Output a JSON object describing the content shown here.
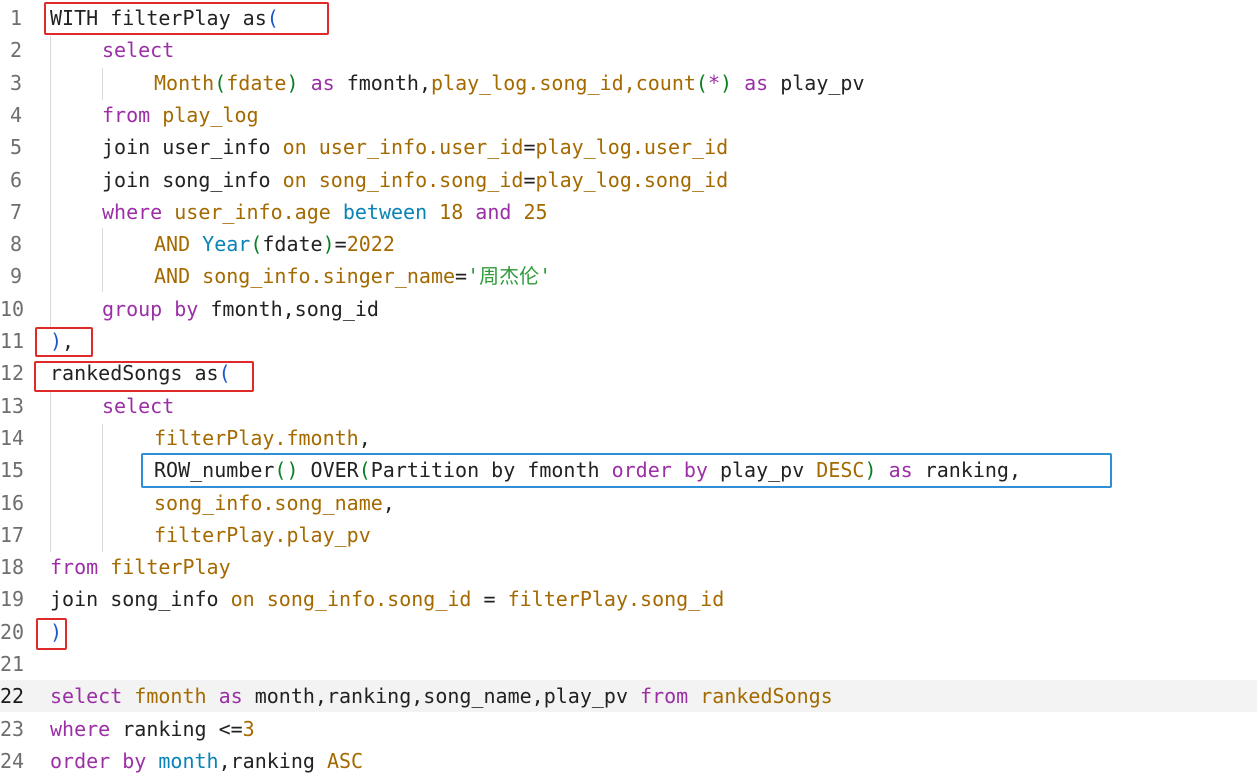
{
  "colors": {
    "default": "#222222",
    "keyword": "#9b2fa6",
    "variable": "#a46a00",
    "function": "#0a84b7",
    "number": "#0a7f24",
    "string": "#2f9b3a",
    "bracket": "#1a58c8",
    "annotation_red": "#e02a2a",
    "annotation_blue": "#2e8fd6"
  },
  "editor": {
    "current_line": 22,
    "lines": [
      {
        "num": "1",
        "indent": 0,
        "tokens": [
          {
            "t": "WITH filterPlay as",
            "c": "default"
          },
          {
            "t": "(",
            "c": "bracket"
          }
        ]
      },
      {
        "num": "2",
        "indent": 1,
        "tokens": [
          {
            "t": "select",
            "c": "keyword"
          }
        ]
      },
      {
        "num": "3",
        "indent": 2,
        "tokens": [
          {
            "t": "Month",
            "c": "variable"
          },
          {
            "t": "(",
            "c": "number"
          },
          {
            "t": "fdate",
            "c": "variable"
          },
          {
            "t": ")",
            "c": "number"
          },
          {
            "t": " as ",
            "c": "keyword"
          },
          {
            "t": "fmonth,",
            "c": "default"
          },
          {
            "t": "play_log.song_id,count",
            "c": "variable"
          },
          {
            "t": "(",
            "c": "number"
          },
          {
            "t": "*",
            "c": "keyword"
          },
          {
            "t": ")",
            "c": "number"
          },
          {
            "t": " as ",
            "c": "keyword"
          },
          {
            "t": "play_pv",
            "c": "default"
          }
        ]
      },
      {
        "num": "4",
        "indent": 1,
        "tokens": [
          {
            "t": "from ",
            "c": "keyword"
          },
          {
            "t": "play_log",
            "c": "variable"
          }
        ]
      },
      {
        "num": "5",
        "indent": 1,
        "tokens": [
          {
            "t": "join user_info ",
            "c": "default"
          },
          {
            "t": "on ",
            "c": "variable"
          },
          {
            "t": "user_info.user_id",
            "c": "variable"
          },
          {
            "t": "=",
            "c": "default"
          },
          {
            "t": "play_log.user_id",
            "c": "variable"
          }
        ]
      },
      {
        "num": "6",
        "indent": 1,
        "tokens": [
          {
            "t": "join song_info ",
            "c": "default"
          },
          {
            "t": "on ",
            "c": "variable"
          },
          {
            "t": "song_info.song_id",
            "c": "variable"
          },
          {
            "t": "=",
            "c": "default"
          },
          {
            "t": "play_log.song_id",
            "c": "variable"
          }
        ]
      },
      {
        "num": "7",
        "indent": 1,
        "tokens": [
          {
            "t": "where ",
            "c": "keyword"
          },
          {
            "t": "user_info.age ",
            "c": "variable"
          },
          {
            "t": "between ",
            "c": "function"
          },
          {
            "t": "18 ",
            "c": "variable"
          },
          {
            "t": "and ",
            "c": "keyword"
          },
          {
            "t": "25",
            "c": "variable"
          }
        ]
      },
      {
        "num": "8",
        "indent": 2,
        "tokens": [
          {
            "t": "AND ",
            "c": "variable"
          },
          {
            "t": "Year",
            "c": "function"
          },
          {
            "t": "(",
            "c": "number"
          },
          {
            "t": "fdate",
            "c": "default"
          },
          {
            "t": ")",
            "c": "number"
          },
          {
            "t": "=",
            "c": "default"
          },
          {
            "t": "2022",
            "c": "variable"
          }
        ]
      },
      {
        "num": "9",
        "indent": 2,
        "tokens": [
          {
            "t": "AND ",
            "c": "variable"
          },
          {
            "t": "song_info.singer_name",
            "c": "variable"
          },
          {
            "t": "=",
            "c": "default"
          },
          {
            "t": "'周杰伦'",
            "c": "string"
          }
        ]
      },
      {
        "num": "10",
        "indent": 1,
        "tokens": [
          {
            "t": "group by ",
            "c": "keyword"
          },
          {
            "t": "fmonth,song_id",
            "c": "default"
          }
        ]
      },
      {
        "num": "11",
        "indent": 0,
        "tokens": [
          {
            "t": ")",
            "c": "bracket"
          },
          {
            "t": ",",
            "c": "default"
          }
        ]
      },
      {
        "num": "12",
        "indent": 0,
        "tokens": [
          {
            "t": "rankedSongs as",
            "c": "default"
          },
          {
            "t": "(",
            "c": "bracket"
          }
        ]
      },
      {
        "num": "13",
        "indent": 1,
        "tokens": [
          {
            "t": "select",
            "c": "keyword"
          }
        ]
      },
      {
        "num": "14",
        "indent": 2,
        "tokens": [
          {
            "t": "filterPlay.fmonth",
            "c": "variable"
          },
          {
            "t": ",",
            "c": "default"
          }
        ]
      },
      {
        "num": "15",
        "indent": 2,
        "tokens": [
          {
            "t": "ROW_number",
            "c": "default"
          },
          {
            "t": "() ",
            "c": "number"
          },
          {
            "t": "OVER",
            "c": "default"
          },
          {
            "t": "(",
            "c": "number"
          },
          {
            "t": "Partition by fmonth ",
            "c": "default"
          },
          {
            "t": "order by ",
            "c": "keyword"
          },
          {
            "t": "play_pv ",
            "c": "default"
          },
          {
            "t": "DESC",
            "c": "variable"
          },
          {
            "t": ") ",
            "c": "number"
          },
          {
            "t": "as ",
            "c": "keyword"
          },
          {
            "t": "ranking,",
            "c": "default"
          }
        ]
      },
      {
        "num": "16",
        "indent": 2,
        "tokens": [
          {
            "t": "song_info.song_name",
            "c": "variable"
          },
          {
            "t": ",",
            "c": "default"
          }
        ]
      },
      {
        "num": "17",
        "indent": 2,
        "tokens": [
          {
            "t": "filterPlay.play_pv",
            "c": "variable"
          }
        ]
      },
      {
        "num": "18",
        "indent": 0,
        "tokens": [
          {
            "t": "from ",
            "c": "keyword"
          },
          {
            "t": "filterPlay",
            "c": "variable"
          }
        ]
      },
      {
        "num": "19",
        "indent": 0,
        "tokens": [
          {
            "t": "join song_info ",
            "c": "default"
          },
          {
            "t": "on ",
            "c": "variable"
          },
          {
            "t": "song_info.song_id ",
            "c": "variable"
          },
          {
            "t": "= ",
            "c": "default"
          },
          {
            "t": "filterPlay.song_id",
            "c": "variable"
          }
        ]
      },
      {
        "num": "20",
        "indent": 0,
        "tokens": [
          {
            "t": ")",
            "c": "bracket"
          }
        ]
      },
      {
        "num": "21",
        "indent": 0,
        "tokens": []
      },
      {
        "num": "22",
        "indent": 0,
        "tokens": [
          {
            "t": "select ",
            "c": "keyword"
          },
          {
            "t": "fmonth ",
            "c": "variable"
          },
          {
            "t": "as ",
            "c": "keyword"
          },
          {
            "t": "month,ranking,song_name,play_pv ",
            "c": "default"
          },
          {
            "t": "from ",
            "c": "keyword"
          },
          {
            "t": "rankedSongs",
            "c": "variable"
          }
        ]
      },
      {
        "num": "23",
        "indent": 0,
        "tokens": [
          {
            "t": "where ",
            "c": "keyword"
          },
          {
            "t": "ranking ",
            "c": "default"
          },
          {
            "t": "<=",
            "c": "default"
          },
          {
            "t": "3",
            "c": "variable"
          }
        ]
      },
      {
        "num": "24",
        "indent": 0,
        "tokens": [
          {
            "t": "order by ",
            "c": "keyword"
          },
          {
            "t": "month",
            "c": "function"
          },
          {
            "t": ",ranking ",
            "c": "default"
          },
          {
            "t": "ASC",
            "c": "variable"
          }
        ]
      }
    ]
  }
}
